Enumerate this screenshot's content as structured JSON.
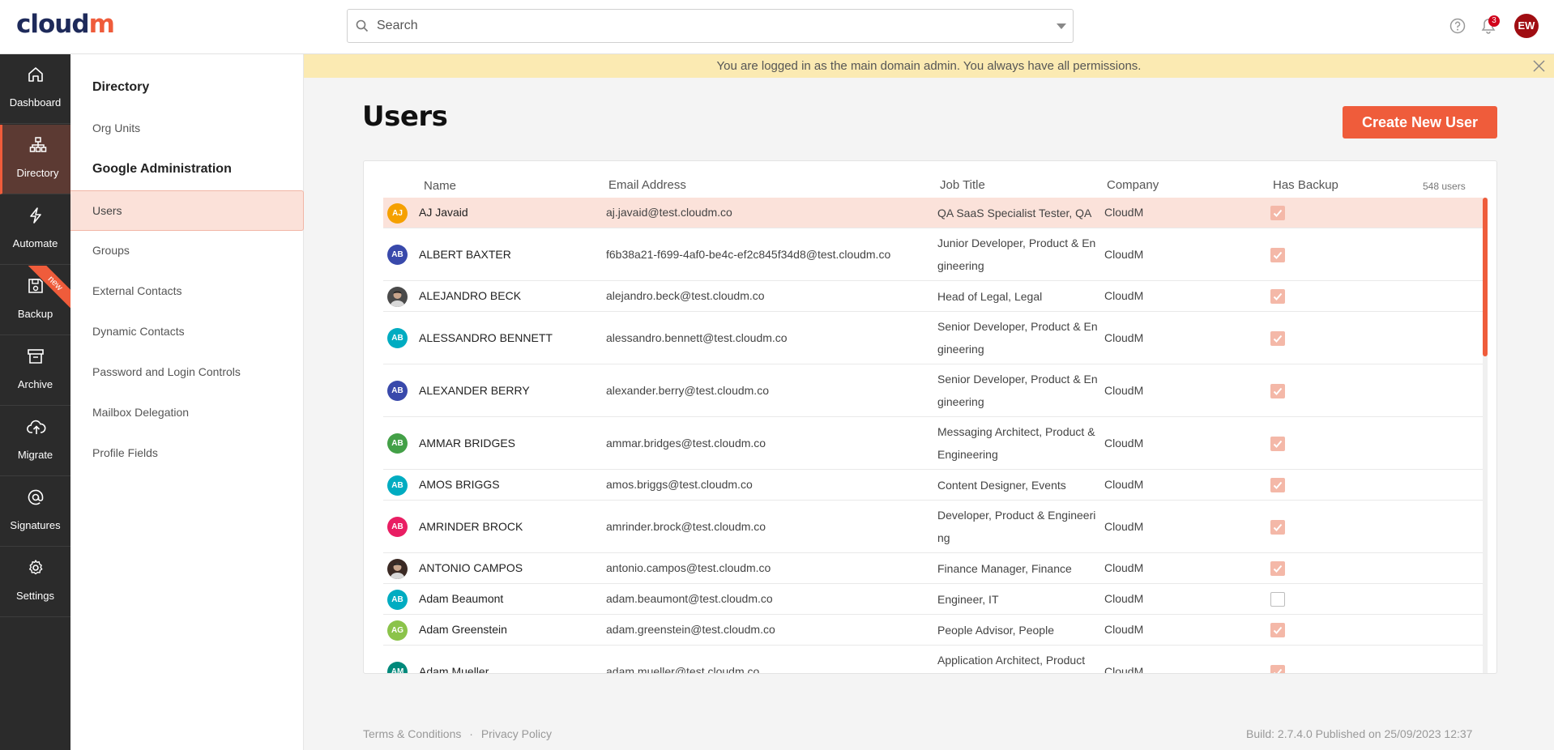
{
  "brand": {
    "logo_main": "cloud",
    "logo_accent": "m"
  },
  "search": {
    "placeholder": "Search"
  },
  "header": {
    "notification_count": "3",
    "user_initials": "EW"
  },
  "nav": {
    "items": [
      {
        "label": "Dashboard",
        "icon": "home-icon"
      },
      {
        "label": "Directory",
        "icon": "org-chart-icon",
        "active": true
      },
      {
        "label": "Automate",
        "icon": "lightning-icon"
      },
      {
        "label": "Backup",
        "icon": "floppy-disk-icon",
        "ribbon": "new"
      },
      {
        "label": "Archive",
        "icon": "archive-box-icon"
      },
      {
        "label": "Migrate",
        "icon": "cloud-upload-icon"
      },
      {
        "label": "Signatures",
        "icon": "at-sign-icon"
      },
      {
        "label": "Settings",
        "icon": "gear-icon"
      }
    ]
  },
  "subnav": {
    "directory_heading": "Directory",
    "org_units": "Org Units",
    "google_heading": "Google Administration",
    "items": [
      "Users",
      "Groups",
      "External Contacts",
      "Dynamic Contacts",
      "Password and Login Controls",
      "Mailbox Delegation",
      "Profile Fields"
    ]
  },
  "banner": {
    "text": "You are logged in as the main domain admin. You always have all permissions."
  },
  "page": {
    "title": "Users",
    "create_label": "Create New User"
  },
  "table": {
    "headers": {
      "name": "Name",
      "email": "Email Address",
      "job": "Job Title",
      "company": "Company",
      "backup": "Has Backup"
    },
    "count": "548 users",
    "rows": [
      {
        "initials": "AJ",
        "color": "#f5a000",
        "name": "AJ Javaid",
        "email": "aj.javaid@test.cloudm.co",
        "job": "QA SaaS Specialist Tester, QA",
        "company": "CloudM",
        "backup": true,
        "selected": true
      },
      {
        "initials": "AB",
        "color": "#3949ab",
        "name": "ALBERT BAXTER",
        "email": "f6b38a21-f699-4af0-be4c-ef2c845f34d8@test.cloudm.co",
        "job": "Junior Developer, Product & Engineering",
        "company": "CloudM",
        "backup": true
      },
      {
        "initials": "",
        "color": "#4a4a4a",
        "photo": true,
        "name": "ALEJANDRO BECK",
        "email": "alejandro.beck@test.cloudm.co",
        "job": "Head of Legal, Legal",
        "company": "CloudM",
        "backup": true
      },
      {
        "initials": "AB",
        "color": "#00acc1",
        "name": "ALESSANDRO BENNETT",
        "email": "alessandro.bennett@test.cloudm.co",
        "job": "Senior Developer, Product & Engineering",
        "company": "CloudM",
        "backup": true
      },
      {
        "initials": "AB",
        "color": "#3949ab",
        "name": "ALEXANDER BERRY",
        "email": "alexander.berry@test.cloudm.co",
        "job": "Senior Developer, Product & Engineering",
        "company": "CloudM",
        "backup": true
      },
      {
        "initials": "AB",
        "color": "#43a047",
        "name": "AMMAR BRIDGES",
        "email": "ammar.bridges@test.cloudm.co",
        "job": "Messaging Architect, Product & Engineering",
        "company": "CloudM",
        "backup": true
      },
      {
        "initials": "AB",
        "color": "#00acc1",
        "name": "AMOS BRIGGS",
        "email": "amos.briggs@test.cloudm.co",
        "job": "Content Designer, Events",
        "company": "CloudM",
        "backup": true
      },
      {
        "initials": "AB",
        "color": "#e91e63",
        "name": "AMRINDER BROCK",
        "email": "amrinder.brock@test.cloudm.co",
        "job": "Developer, Product & Engineering",
        "company": "CloudM",
        "backup": true
      },
      {
        "initials": "",
        "color": "#3b2a24",
        "photo": true,
        "name": "ANTONIO CAMPOS",
        "email": "antonio.campos@test.cloudm.co",
        "job": "Finance Manager, Finance",
        "company": "CloudM",
        "backup": true
      },
      {
        "initials": "AB",
        "color": "#00acc1",
        "name": "Adam Beaumont",
        "email": "adam.beaumont@test.cloudm.co",
        "job": "Engineer, IT",
        "company": "CloudM",
        "backup": false
      },
      {
        "initials": "AG",
        "color": "#8bc34a",
        "name": "Adam Greenstein",
        "email": "adam.greenstein@test.cloudm.co",
        "job": "People Advisor, People",
        "company": "CloudM",
        "backup": true
      },
      {
        "initials": "AM",
        "color": "#00897b",
        "name": "Adam Mueller",
        "email": "adam.mueller@test.cloudm.co",
        "job": "Application Architect, Product",
        "company": "CloudM",
        "backup": true
      }
    ]
  },
  "footer": {
    "terms": "Terms & Conditions",
    "separator": "·",
    "privacy": "Privacy Policy",
    "build": "Build: 2.7.4.0 Published on 25/09/2023 12:37"
  }
}
